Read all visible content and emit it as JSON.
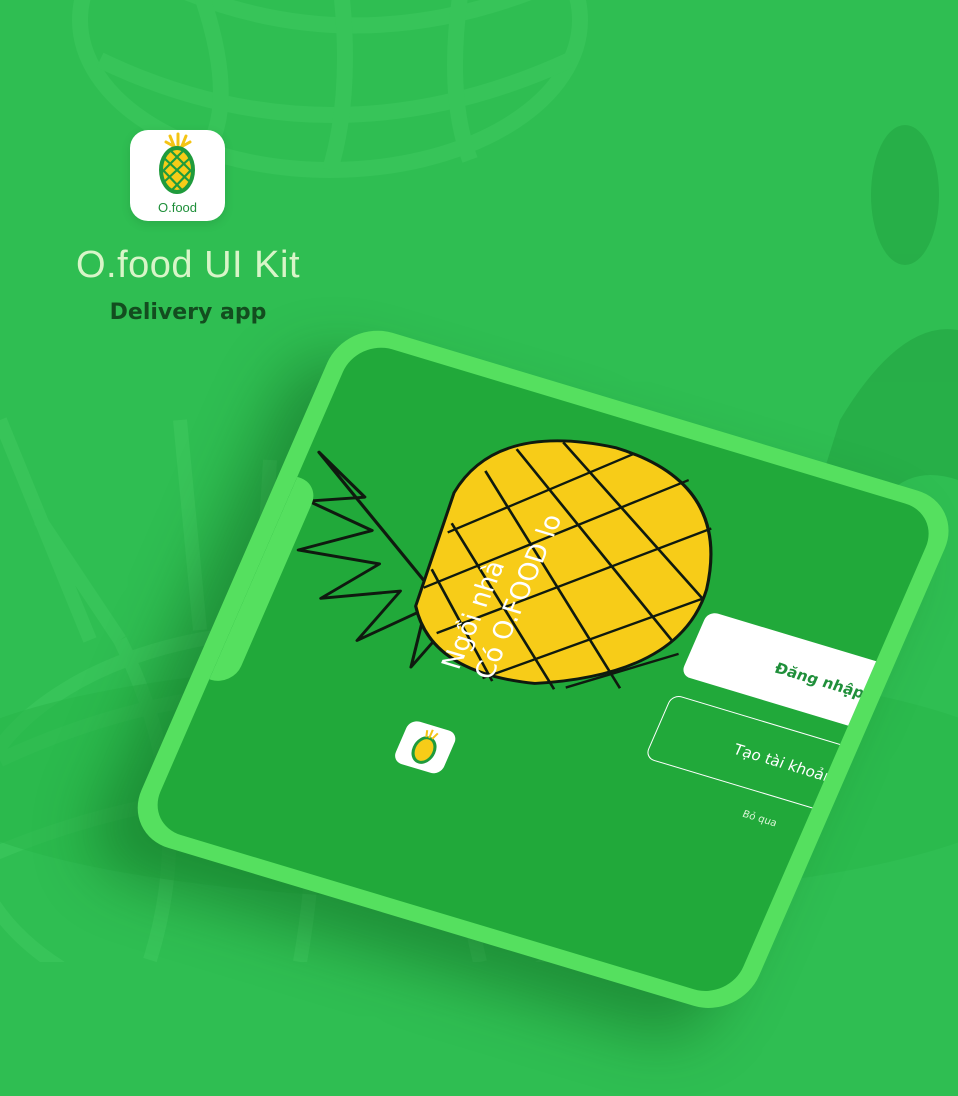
{
  "brand": {
    "icon_label": "O.food",
    "title": "O.food UI Kit",
    "subtitle": "Delivery app"
  },
  "phone": {
    "tagline_line1": "Ngồi nhà",
    "tagline_line2": "Có O.FOOD lo",
    "login_label": "Đăng nhập",
    "register_label": "Tạo tài khoản",
    "skip_label": "Bỏ qua"
  },
  "colors": {
    "background": "#2fbe52",
    "phone_frame": "#55e05f",
    "screen": "#21a93a",
    "pineapple": "#f7cc18",
    "subtitle_text": "#134d1f"
  }
}
